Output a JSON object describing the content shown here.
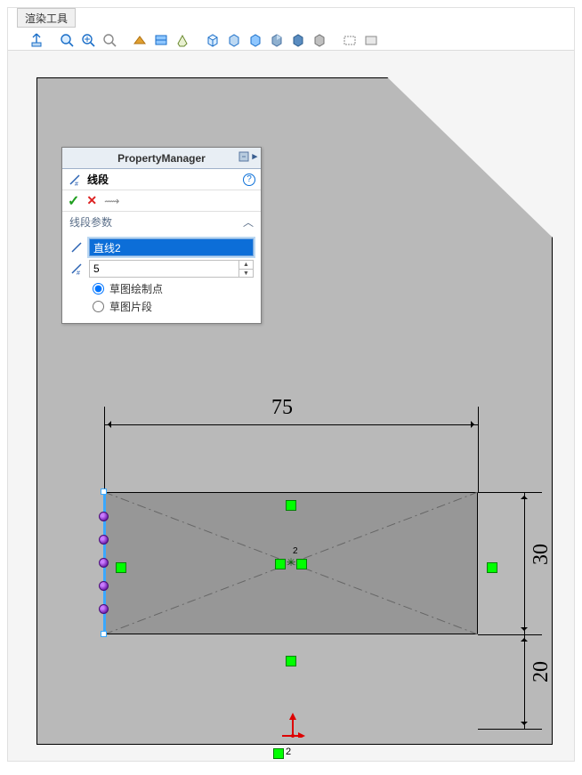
{
  "tabs": {
    "render_tools": "渲染工具"
  },
  "pm": {
    "header": "PropertyManager",
    "title": "线段",
    "section": "线段参数",
    "sel_entity": "直线2",
    "count_value": "5",
    "radio_points": "草图绘制点",
    "radio_segments": "草图片段"
  },
  "dims": {
    "top": "75",
    "right_upper": "30",
    "right_lower": "20"
  },
  "origin_label": "2",
  "center_label": "2"
}
